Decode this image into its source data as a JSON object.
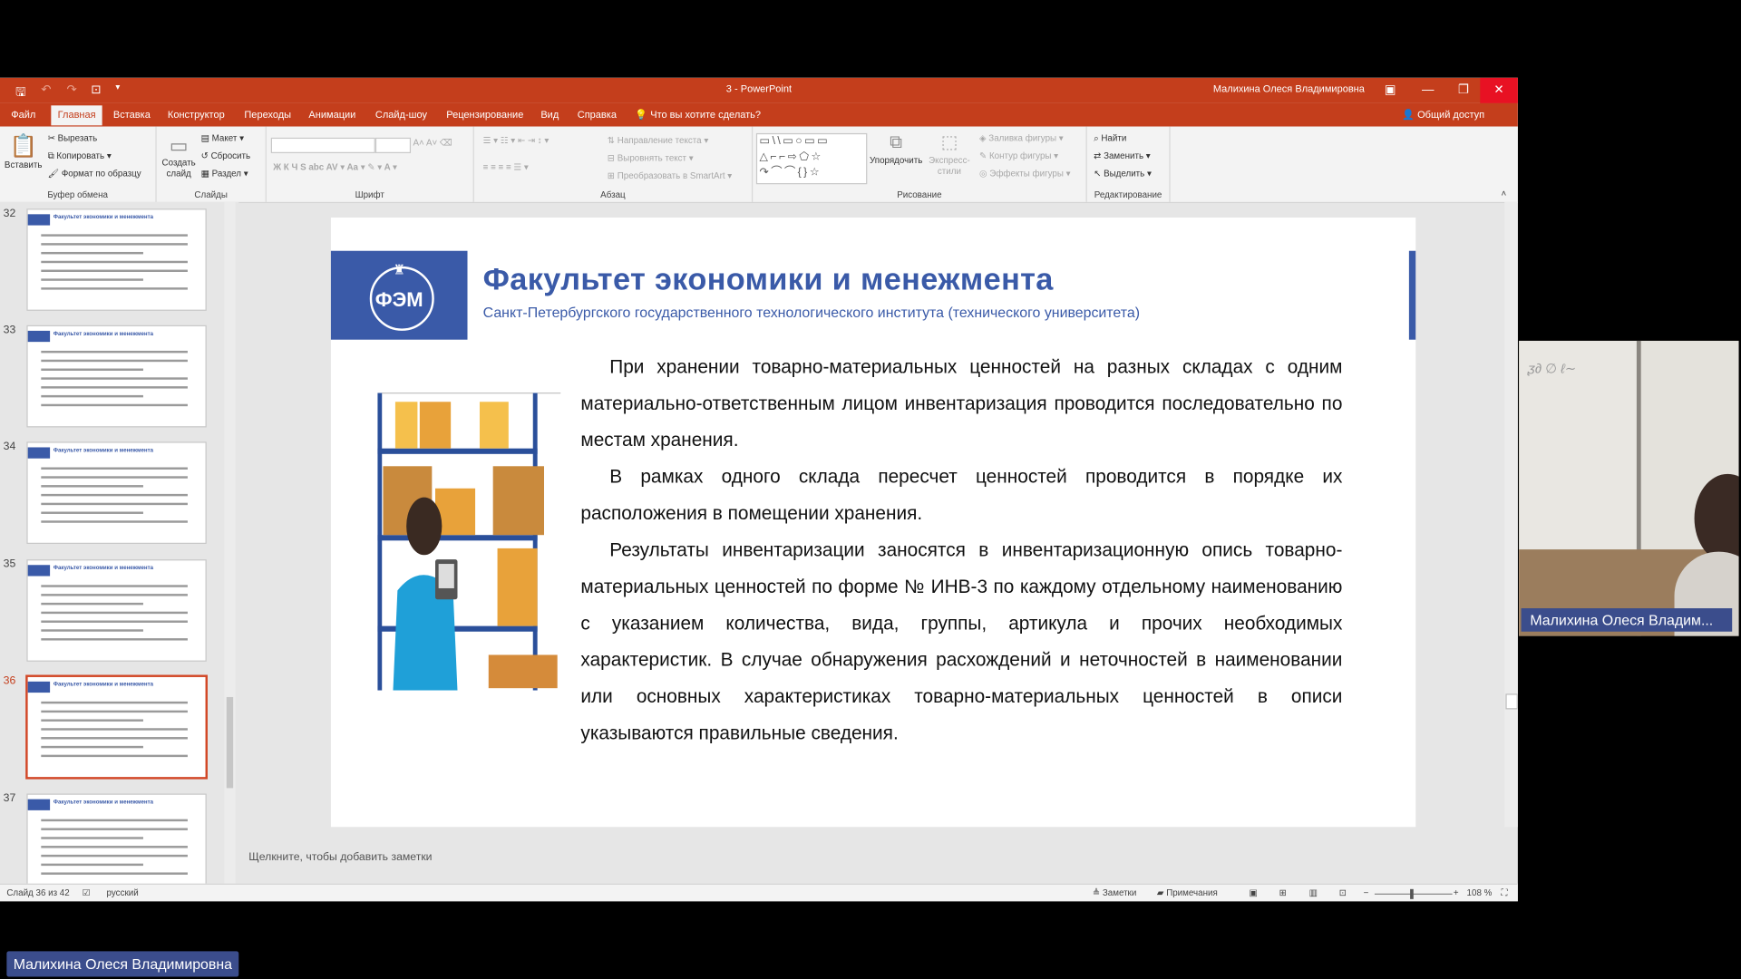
{
  "window": {
    "title": "3 - PowerPoint",
    "user": "Малихина Олеся Владимировна",
    "brand_color": "#c43e1c",
    "accent_color": "#3a5aa8"
  },
  "tabs": [
    {
      "label": "Файл"
    },
    {
      "label": "Главная"
    },
    {
      "label": "Вставка"
    },
    {
      "label": "Конструктор"
    },
    {
      "label": "Переходы"
    },
    {
      "label": "Анимации"
    },
    {
      "label": "Слайд-шоу"
    },
    {
      "label": "Рецензирование"
    },
    {
      "label": "Вид"
    },
    {
      "label": "Справка"
    }
  ],
  "tell_me": "Что вы хотите сделать?",
  "share": "Общий доступ",
  "ribbon": {
    "paste": "Вставить",
    "cut": "Вырезать",
    "copy": "Копировать",
    "format_painter": "Формат по образцу",
    "clipboard": "Буфер обмена",
    "new_slide": "Создать слайд",
    "layout": "Макет",
    "reset": "Сбросить",
    "section": "Раздел",
    "slides": "Слайды",
    "font": "Шрифт",
    "paragraph": "Абзац",
    "text_direction": "Направление текста",
    "align_text": "Выровнять текст",
    "smartart": "Преобразовать в SmartArt",
    "arrange": "Упорядочить",
    "quick_styles": "Экспресс-стили",
    "shape_fill": "Заливка фигуры",
    "shape_outline": "Контур фигуры",
    "shape_effects": "Эффекты фигуры",
    "drawing": "Рисование",
    "find": "Найти",
    "replace": "Заменить",
    "select": "Выделить",
    "editing": "Редактирование"
  },
  "thumbnails": [
    {
      "num": "32",
      "title": "Факультет экономики и менежмента"
    },
    {
      "num": "33",
      "title": "Факультет экономики и менежмента"
    },
    {
      "num": "34",
      "title": "Факультет экономики и менежмента"
    },
    {
      "num": "35",
      "title": "Факультет экономики и менежмента"
    },
    {
      "num": "36",
      "title": "Факультет экономики и менежмента",
      "active": true
    },
    {
      "num": "37",
      "title": "Факультет экономики и менежмента"
    }
  ],
  "slide": {
    "logo_text": "ФЭМ",
    "title": "Факультет экономики и менежмента",
    "subtitle": "Санкт-Петербургского государственного технологического института (технического университета)",
    "paragraphs": [
      "При хранении товарно-материальных ценностей на разных складах с одним материально-ответственным лицом инвентаризация проводится последовательно по местам хранения.",
      "В рамках одного склада пересчет ценностей проводится в порядке их расположения в помещении хранения.",
      "Результаты инвентаризации заносятся в инвентаризационную опись товарно-материальных ценностей по форме № ИНВ-3 по каждому отдельному наименованию с указанием количества, вида, группы, артикула и прочих необходимых характеристик. В случае обнаружения расхождений и неточностей в наименовании или основных характеристиках товарно-материальных ценностей в описи указываются правильные сведения."
    ]
  },
  "notes_placeholder": "Щелкните, чтобы добавить заметки",
  "status": {
    "slide_info": "Слайд 36 из 42",
    "language": "русский",
    "notes": "Заметки",
    "comments": "Примечания",
    "zoom": "108 %"
  },
  "video": {
    "camera_name": "Малихина Олеся Владим...",
    "bottom_name": "Малихина Олеся Владимировна"
  }
}
